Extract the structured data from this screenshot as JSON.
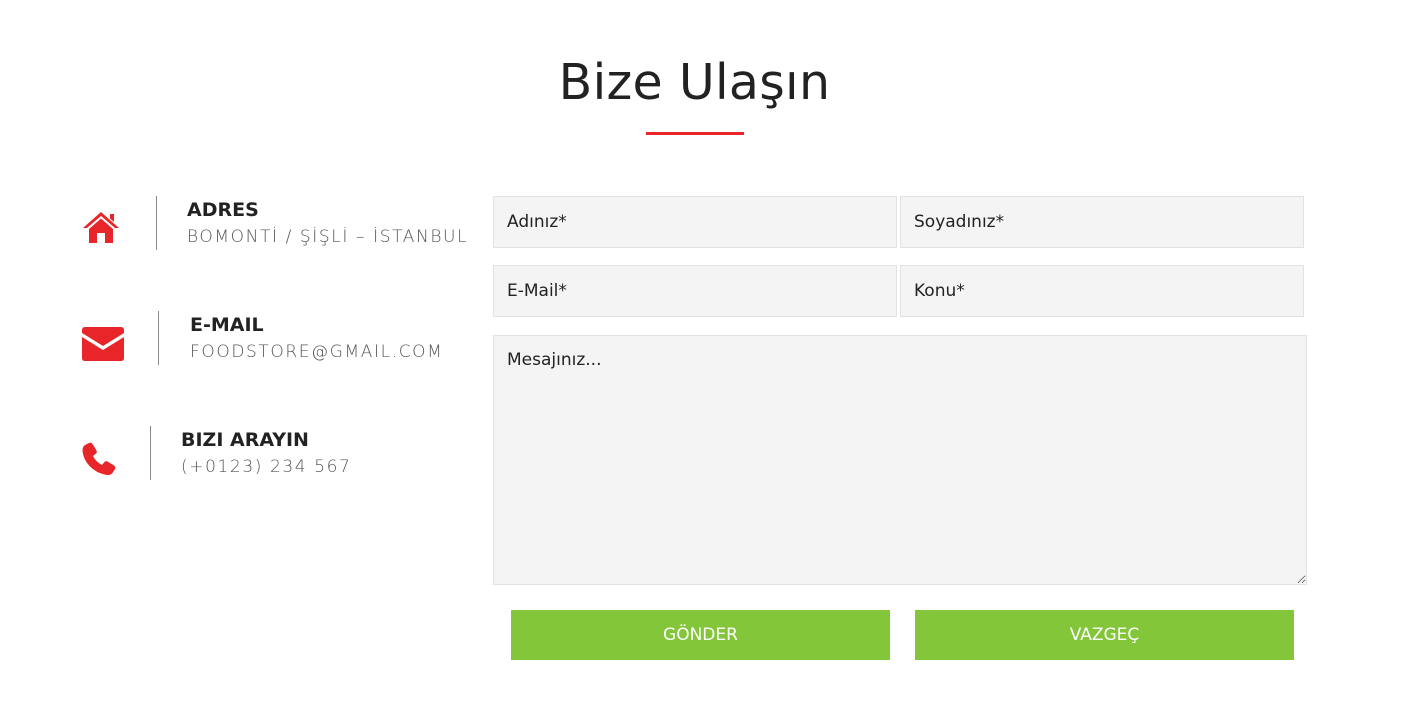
{
  "heading": {
    "title": "Bize Ulaşın"
  },
  "contact_info": [
    {
      "icon": "home-icon",
      "title": "ADRES",
      "value": "BOMONTİ / ŞİŞLİ – İSTANBUL"
    },
    {
      "icon": "envelope-icon",
      "title": "E-MAIL",
      "value": "FOODSTORE@GMAIL.COM"
    },
    {
      "icon": "phone-icon",
      "title": "BIZI ARAYIN",
      "value": "(+0123) 234 567"
    }
  ],
  "form": {
    "first_name_placeholder": "Adınız*",
    "last_name_placeholder": "Soyadınız*",
    "email_placeholder": "E-Mail*",
    "subject_placeholder": "Konu*",
    "message_placeholder": "Mesajınız...",
    "submit_label": "GÖNDER",
    "cancel_label": "VAZGEÇ"
  },
  "colors": {
    "accent_red": "#e8262a",
    "button_green": "#84c63a",
    "field_bg": "#f4f4f4"
  }
}
